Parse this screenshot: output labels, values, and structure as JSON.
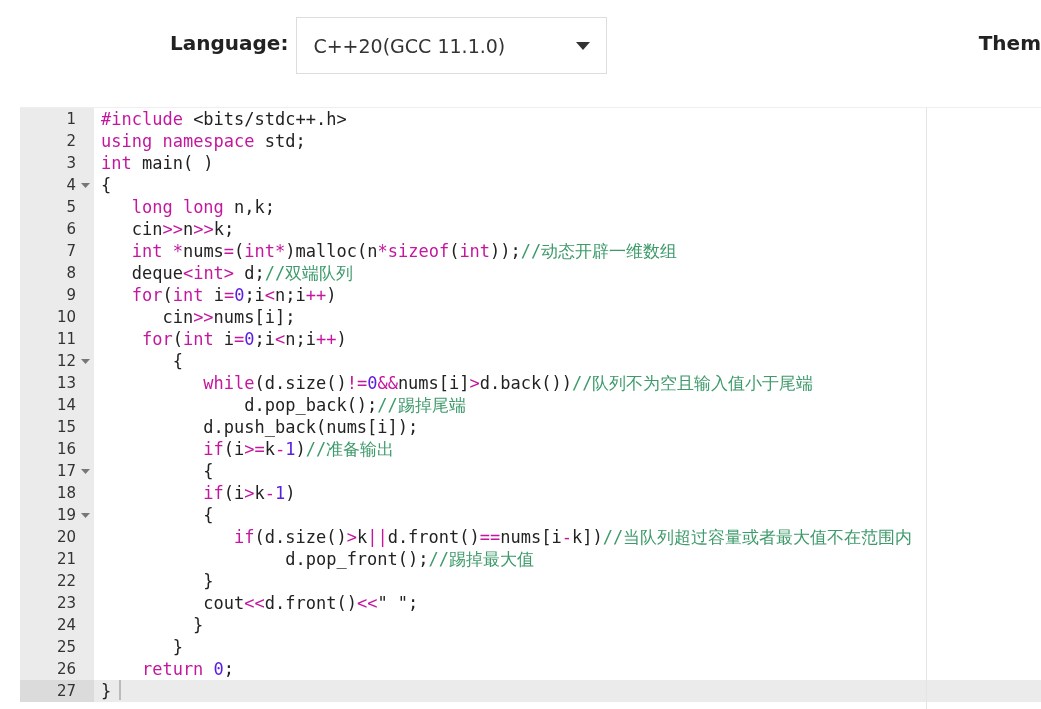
{
  "toolbar": {
    "language_label": "Language:",
    "language_select": {
      "value": "C++20(GCC 11.1.0)"
    },
    "theme_label": "Them"
  },
  "editor": {
    "lines": [
      {
        "number": "1",
        "foldable": false,
        "active": false,
        "tokens": [
          {
            "kind": "keyword",
            "text": "#include"
          },
          {
            "kind": "text",
            "text": " <bits/stdc++.h>"
          }
        ]
      },
      {
        "number": "2",
        "foldable": false,
        "active": false,
        "tokens": [
          {
            "kind": "keyword",
            "text": "using"
          },
          {
            "kind": "keyword",
            "text": " namespace"
          },
          {
            "kind": "text",
            "text": " std;"
          }
        ]
      },
      {
        "number": "3",
        "foldable": false,
        "active": false,
        "tokens": [
          {
            "kind": "keyword",
            "text": "int"
          },
          {
            "kind": "text",
            "text": " main( )"
          }
        ]
      },
      {
        "number": "4",
        "foldable": true,
        "active": false,
        "tokens": [
          {
            "kind": "text",
            "text": "{"
          }
        ]
      },
      {
        "number": "5",
        "foldable": false,
        "active": false,
        "tokens": [
          {
            "kind": "keyword",
            "text": "   long"
          },
          {
            "kind": "keyword",
            "text": " long"
          },
          {
            "kind": "text",
            "text": " n,k;"
          }
        ]
      },
      {
        "number": "6",
        "foldable": false,
        "active": false,
        "tokens": [
          {
            "kind": "text",
            "text": "   cin"
          },
          {
            "kind": "operator",
            "text": ">>"
          },
          {
            "kind": "text",
            "text": "n"
          },
          {
            "kind": "operator",
            "text": ">>"
          },
          {
            "kind": "text",
            "text": "k;"
          }
        ]
      },
      {
        "number": "7",
        "foldable": false,
        "active": false,
        "tokens": [
          {
            "kind": "keyword",
            "text": "   int"
          },
          {
            "kind": "operator",
            "text": " *"
          },
          {
            "kind": "text",
            "text": "nums"
          },
          {
            "kind": "operator",
            "text": "="
          },
          {
            "kind": "text",
            "text": "("
          },
          {
            "kind": "keyword",
            "text": "int"
          },
          {
            "kind": "operator",
            "text": "*"
          },
          {
            "kind": "text",
            "text": ")malloc(n"
          },
          {
            "kind": "operator",
            "text": "*"
          },
          {
            "kind": "keyword",
            "text": "sizeof"
          },
          {
            "kind": "text",
            "text": "("
          },
          {
            "kind": "keyword",
            "text": "int"
          },
          {
            "kind": "text",
            "text": "));"
          },
          {
            "kind": "comment",
            "text": "//动态开辟一维数组"
          }
        ]
      },
      {
        "number": "8",
        "foldable": false,
        "active": false,
        "tokens": [
          {
            "kind": "text",
            "text": "   deque"
          },
          {
            "kind": "operator",
            "text": "<"
          },
          {
            "kind": "keyword",
            "text": "int"
          },
          {
            "kind": "operator",
            "text": ">"
          },
          {
            "kind": "text",
            "text": " d;"
          },
          {
            "kind": "comment",
            "text": "//双端队列"
          }
        ]
      },
      {
        "number": "9",
        "foldable": false,
        "active": false,
        "tokens": [
          {
            "kind": "keyword",
            "text": "   for"
          },
          {
            "kind": "text",
            "text": "("
          },
          {
            "kind": "keyword",
            "text": "int"
          },
          {
            "kind": "text",
            "text": " i"
          },
          {
            "kind": "operator",
            "text": "="
          },
          {
            "kind": "number",
            "text": "0"
          },
          {
            "kind": "text",
            "text": ";i"
          },
          {
            "kind": "operator",
            "text": "<"
          },
          {
            "kind": "text",
            "text": "n;i"
          },
          {
            "kind": "operator",
            "text": "++"
          },
          {
            "kind": "text",
            "text": ")"
          }
        ]
      },
      {
        "number": "10",
        "foldable": false,
        "active": false,
        "tokens": [
          {
            "kind": "text",
            "text": "      cin"
          },
          {
            "kind": "operator",
            "text": ">>"
          },
          {
            "kind": "text",
            "text": "nums[i];"
          }
        ]
      },
      {
        "number": "11",
        "foldable": false,
        "active": false,
        "tokens": [
          {
            "kind": "keyword",
            "text": "    for"
          },
          {
            "kind": "text",
            "text": "("
          },
          {
            "kind": "keyword",
            "text": "int"
          },
          {
            "kind": "text",
            "text": " i"
          },
          {
            "kind": "operator",
            "text": "="
          },
          {
            "kind": "number",
            "text": "0"
          },
          {
            "kind": "text",
            "text": ";i"
          },
          {
            "kind": "operator",
            "text": "<"
          },
          {
            "kind": "text",
            "text": "n;i"
          },
          {
            "kind": "operator",
            "text": "++"
          },
          {
            "kind": "text",
            "text": ")"
          }
        ]
      },
      {
        "number": "12",
        "foldable": true,
        "active": false,
        "tokens": [
          {
            "kind": "text",
            "text": "       {"
          }
        ]
      },
      {
        "number": "13",
        "foldable": false,
        "active": false,
        "tokens": [
          {
            "kind": "keyword",
            "text": "          while"
          },
          {
            "kind": "text",
            "text": "(d.size()"
          },
          {
            "kind": "operator",
            "text": "!="
          },
          {
            "kind": "number",
            "text": "0"
          },
          {
            "kind": "operator",
            "text": "&&"
          },
          {
            "kind": "text",
            "text": "nums[i]"
          },
          {
            "kind": "operator",
            "text": ">"
          },
          {
            "kind": "text",
            "text": "d.back())"
          },
          {
            "kind": "comment",
            "text": "//队列不为空且输入值小于尾端"
          }
        ]
      },
      {
        "number": "14",
        "foldable": false,
        "active": false,
        "tokens": [
          {
            "kind": "text",
            "text": "              d.pop_back();"
          },
          {
            "kind": "comment",
            "text": "//踢掉尾端"
          }
        ]
      },
      {
        "number": "15",
        "foldable": false,
        "active": false,
        "tokens": [
          {
            "kind": "text",
            "text": "          d.push_back(nums[i]);"
          }
        ]
      },
      {
        "number": "16",
        "foldable": false,
        "active": false,
        "tokens": [
          {
            "kind": "keyword",
            "text": "          if"
          },
          {
            "kind": "text",
            "text": "(i"
          },
          {
            "kind": "operator",
            "text": ">="
          },
          {
            "kind": "text",
            "text": "k"
          },
          {
            "kind": "operator",
            "text": "-"
          },
          {
            "kind": "number",
            "text": "1"
          },
          {
            "kind": "text",
            "text": ")"
          },
          {
            "kind": "comment",
            "text": "//准备输出"
          }
        ]
      },
      {
        "number": "17",
        "foldable": true,
        "active": false,
        "tokens": [
          {
            "kind": "text",
            "text": "          {"
          }
        ]
      },
      {
        "number": "18",
        "foldable": false,
        "active": false,
        "tokens": [
          {
            "kind": "keyword",
            "text": "          if"
          },
          {
            "kind": "text",
            "text": "(i"
          },
          {
            "kind": "operator",
            "text": ">"
          },
          {
            "kind": "text",
            "text": "k"
          },
          {
            "kind": "operator",
            "text": "-"
          },
          {
            "kind": "number",
            "text": "1"
          },
          {
            "kind": "text",
            "text": ")"
          }
        ]
      },
      {
        "number": "19",
        "foldable": true,
        "active": false,
        "tokens": [
          {
            "kind": "text",
            "text": "          {"
          }
        ]
      },
      {
        "number": "20",
        "foldable": false,
        "active": false,
        "tokens": [
          {
            "kind": "keyword",
            "text": "             if"
          },
          {
            "kind": "text",
            "text": "(d.size()"
          },
          {
            "kind": "operator",
            "text": ">"
          },
          {
            "kind": "text",
            "text": "k"
          },
          {
            "kind": "operator",
            "text": "||"
          },
          {
            "kind": "text",
            "text": "d.front()"
          },
          {
            "kind": "operator",
            "text": "=="
          },
          {
            "kind": "text",
            "text": "nums[i"
          },
          {
            "kind": "operator",
            "text": "-"
          },
          {
            "kind": "text",
            "text": "k])"
          },
          {
            "kind": "comment",
            "text": "//当队列超过容量或者最大值不在范围内"
          }
        ]
      },
      {
        "number": "21",
        "foldable": false,
        "active": false,
        "tokens": [
          {
            "kind": "text",
            "text": "                  d.pop_front();"
          },
          {
            "kind": "comment",
            "text": "//踢掉最大值"
          }
        ]
      },
      {
        "number": "22",
        "foldable": false,
        "active": false,
        "tokens": [
          {
            "kind": "text",
            "text": "          }"
          }
        ]
      },
      {
        "number": "23",
        "foldable": false,
        "active": false,
        "tokens": [
          {
            "kind": "text",
            "text": "          cout"
          },
          {
            "kind": "operator",
            "text": "<<"
          },
          {
            "kind": "text",
            "text": "d.front()"
          },
          {
            "kind": "operator",
            "text": "<<"
          },
          {
            "kind": "text",
            "text": "\" \";"
          }
        ]
      },
      {
        "number": "24",
        "foldable": false,
        "active": false,
        "tokens": [
          {
            "kind": "text",
            "text": "         }"
          }
        ]
      },
      {
        "number": "25",
        "foldable": false,
        "active": false,
        "tokens": [
          {
            "kind": "text",
            "text": "       }"
          }
        ]
      },
      {
        "number": "26",
        "foldable": false,
        "active": false,
        "tokens": [
          {
            "kind": "keyword",
            "text": "    return"
          },
          {
            "kind": "number",
            "text": " 0"
          },
          {
            "kind": "text",
            "text": ";"
          }
        ]
      },
      {
        "number": "27",
        "foldable": false,
        "active": true,
        "tokens": [
          {
            "kind": "text",
            "text": "}"
          }
        ]
      }
    ]
  }
}
